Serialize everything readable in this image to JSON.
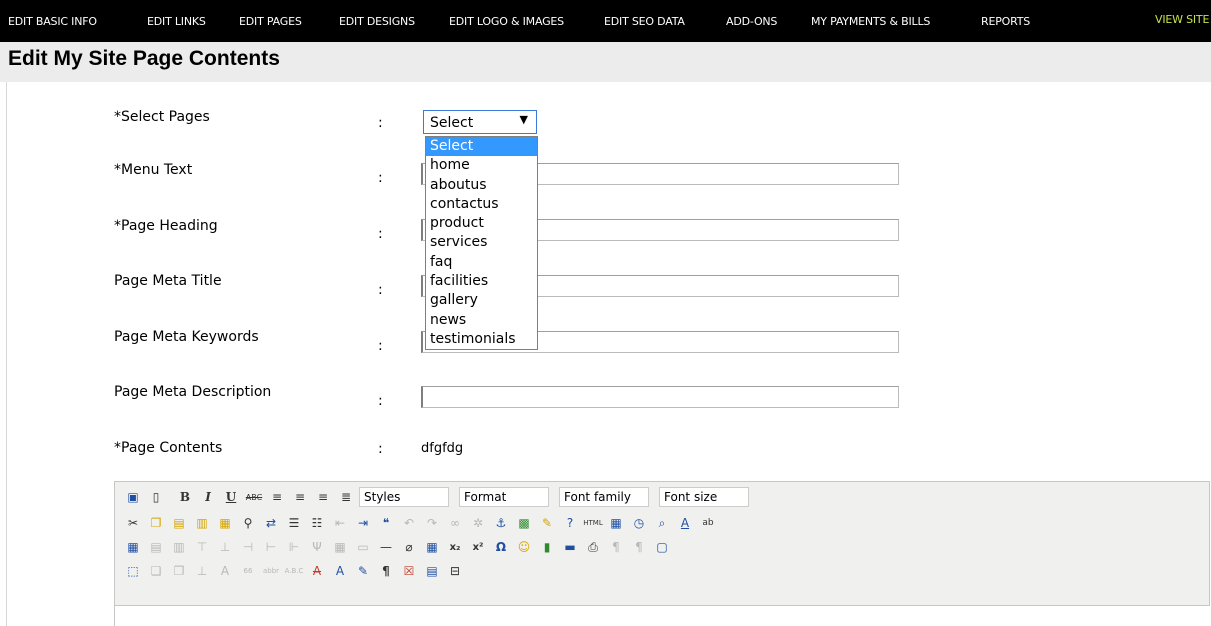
{
  "nav": {
    "items": [
      "EDIT BASIC INFO",
      "EDIT LINKS",
      "EDIT PAGES",
      "EDIT DESIGNS",
      "EDIT LOGO & IMAGES",
      "EDIT SEO DATA",
      "ADD-ONS",
      "MY PAYMENTS & BILLS",
      "REPORTS"
    ],
    "view_site": "VIEW SITE"
  },
  "page": {
    "title": "Edit My Site Page Contents"
  },
  "form": {
    "colon": ":",
    "select_pages_label": "*Select Pages",
    "select_value": "Select",
    "select_options": [
      "Select",
      "home",
      "aboutus",
      "contactus",
      "product",
      "services",
      "faq",
      "facilities",
      "gallery",
      "news",
      "testimonials"
    ],
    "menu_text_label": "*Menu Text",
    "page_heading_label": "*Page Heading",
    "meta_title_label": "Page Meta Title",
    "meta_keywords_label": "Page Meta Keywords",
    "meta_description_label": "Page Meta Description",
    "page_contents_label": "*Page Contents",
    "page_contents_value": "dfgfdg"
  },
  "editor": {
    "styles": "Styles",
    "format": "Format",
    "font_family": "Font family",
    "font_size": "Font size"
  },
  "colors": {
    "nav_bg": "#000000",
    "view_site": "#c8e24a",
    "select_highlight": "#3399ff"
  }
}
